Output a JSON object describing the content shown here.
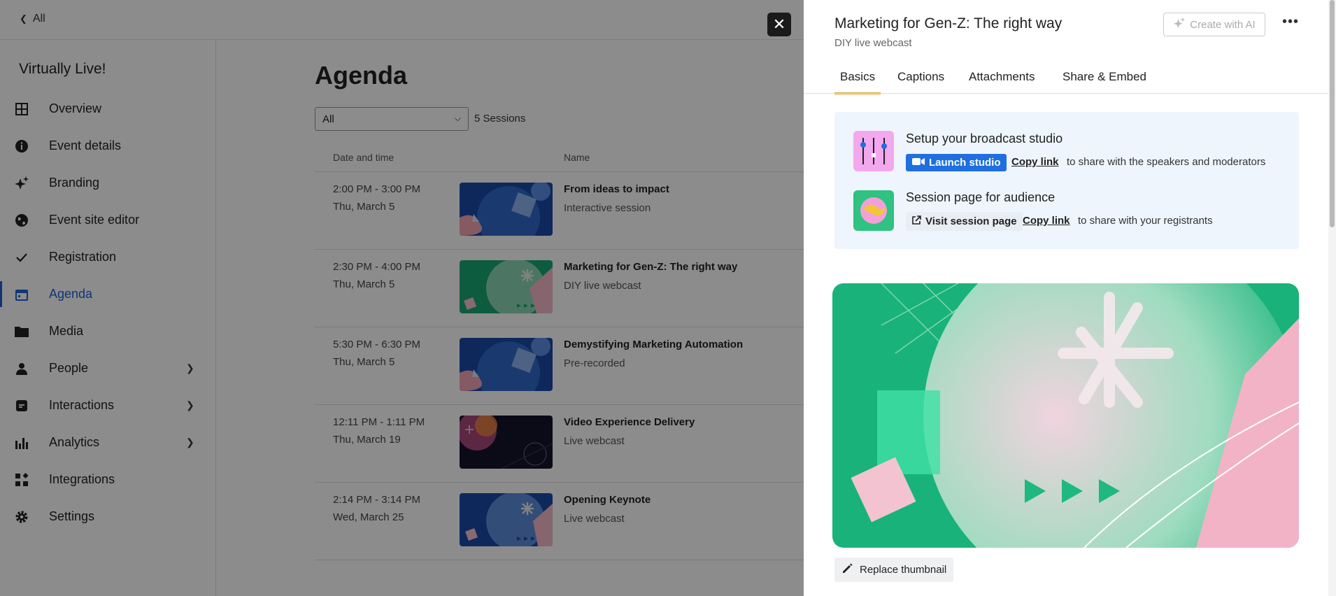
{
  "topbar": {
    "back_label": "All"
  },
  "sidebar": {
    "event_name": "Virtually Live!",
    "items": [
      {
        "label": "Overview",
        "icon": "grid-icon"
      },
      {
        "label": "Event details",
        "icon": "info-icon"
      },
      {
        "label": "Branding",
        "icon": "sparkle-icon"
      },
      {
        "label": "Event site editor",
        "icon": "globe-icon"
      },
      {
        "label": "Registration",
        "icon": "check-icon"
      },
      {
        "label": "Agenda",
        "icon": "calendar-icon",
        "active": true
      },
      {
        "label": "Media",
        "icon": "folder-icon"
      },
      {
        "label": "People",
        "icon": "person-icon",
        "expandable": true
      },
      {
        "label": "Interactions",
        "icon": "chat-icon",
        "expandable": true
      },
      {
        "label": "Analytics",
        "icon": "bar-chart-icon",
        "expandable": true
      },
      {
        "label": "Integrations",
        "icon": "apps-icon"
      },
      {
        "label": "Settings",
        "icon": "gear-icon"
      }
    ]
  },
  "agenda": {
    "title": "Agenda",
    "filter_value": "All",
    "session_count": "5 Sessions",
    "col_date": "Date and time",
    "col_name": "Name",
    "sessions": [
      {
        "time": "2:00 PM - 3:00 PM",
        "date": "Thu, March 5",
        "name": "From ideas to impact",
        "type": "Interactive session"
      },
      {
        "time": "2:30 PM - 4:00 PM",
        "date": "Thu, March 5",
        "name": "Marketing for Gen-Z: The right way",
        "type": "DIY live webcast"
      },
      {
        "time": "5:30 PM - 6:30 PM",
        "date": "Thu, March 5",
        "name": "Demystifying Marketing Automation",
        "type": "Pre-recorded"
      },
      {
        "time": "12:11 PM - 1:11 PM",
        "date": "Thu, March 19",
        "name": "Video Experience Delivery",
        "type": "Live webcast"
      },
      {
        "time": "2:14 PM - 3:14 PM",
        "date": "Wed, March 25",
        "name": "Opening Keynote",
        "type": "Live webcast"
      }
    ]
  },
  "panel": {
    "title": "Marketing for Gen-Z: The right way",
    "subtitle": "DIY live webcast",
    "ai_button": "Create with AI",
    "tabs": [
      "Basics",
      "Captions",
      "Attachments",
      "Share & Embed"
    ],
    "active_tab": "Basics",
    "studio": {
      "heading": "Setup your broadcast studio",
      "launch_label": "Launch studio",
      "copy_label": "Copy link",
      "share_text": "to share with the speakers and moderators"
    },
    "audience": {
      "heading": "Session page for audience",
      "visit_label": "Visit session page",
      "copy_label": "Copy link",
      "share_text": "to share with your registrants"
    },
    "replace_label": "Replace thumbnail"
  },
  "colors": {
    "accent": "#1f6fe0",
    "tab_underline": "#e0a53a",
    "active_nav": "#1f5fd6",
    "studio_bg": "#eef5fd"
  }
}
